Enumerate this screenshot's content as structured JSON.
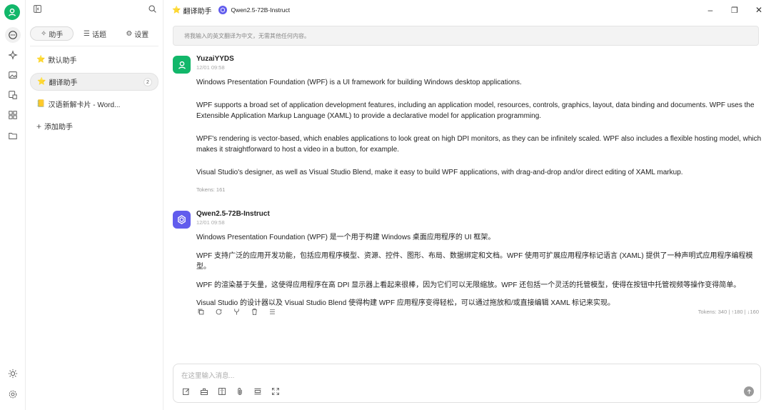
{
  "titlebar": {
    "assistant": "翻译助手",
    "model": "Qwen2.5-72B-Instruct"
  },
  "sidebar": {
    "tabs": [
      {
        "icon": "sparkle-icon",
        "label": "助手"
      },
      {
        "icon": "list-icon",
        "label": "话题"
      },
      {
        "icon": "gear-icon",
        "label": "设置"
      }
    ],
    "items": [
      {
        "emoji": "⭐",
        "label": "默认助手",
        "count": ""
      },
      {
        "emoji": "⭐",
        "label": "翻译助手",
        "count": "2"
      },
      {
        "emoji": "📒",
        "label": "汉语新解卡片 - Word..."
      }
    ],
    "add_label": "添加助手"
  },
  "system_prompt": "将我输入的英文翻译为中文，无需其他任何内容。",
  "messages": [
    {
      "name": "YuzaiYYDS",
      "time": "12/01 09:58",
      "paragraphs": [
        "Windows Presentation Foundation (WPF) is a UI framework for building Windows desktop applications.",
        "WPF supports a broad set of application development features, including an application model, resources, controls, graphics, layout, data binding and documents. WPF uses the Extensible Application Markup Language (XAML) to provide a declarative model for application programming.",
        "WPF's rendering is vector-based, which enables applications to look great on high DPI monitors, as they can be infinitely scaled. WPF also includes a flexible hosting model, which makes it straightforward to host a video in a button, for example.",
        "Visual Studio's designer, as well as Visual Studio Blend, make it easy to build WPF applications, with drag-and-drop and/or direct editing of XAML markup."
      ],
      "tokens": "Tokens: 161"
    },
    {
      "name": "Qwen2.5-72B-Instruct",
      "time": "12/01 09:58",
      "paragraphs": [
        "Windows Presentation Foundation (WPF) 是一个用于构建 Windows 桌面应用程序的 UI 框架。",
        "WPF 支持广泛的应用开发功能，包括应用程序模型、资源、控件、图形、布局、数据绑定和文档。WPF 使用可扩展应用程序标记语言 (XAML) 提供了一种声明式应用程序编程模型。",
        "WPF 的渲染基于矢量，这使得应用程序在高 DPI 显示器上看起来很棒，因为它们可以无限缩放。WPF 还包括一个灵活的托管模型，使得在按钮中托管视频等操作变得简单。",
        "Visual Studio 的设计器以及 Visual Studio Blend 使得构建 WPF 应用程序变得轻松，可以通过拖放和/或直接编辑 XAML 标记来实现。"
      ],
      "tokens": "Tokens: 340 | ↑180 | ↓160"
    }
  ],
  "input": {
    "placeholder": "在这里输入消息..."
  },
  "colors": {
    "accent_green": "#12b76a",
    "model_purple": "#615ced"
  }
}
